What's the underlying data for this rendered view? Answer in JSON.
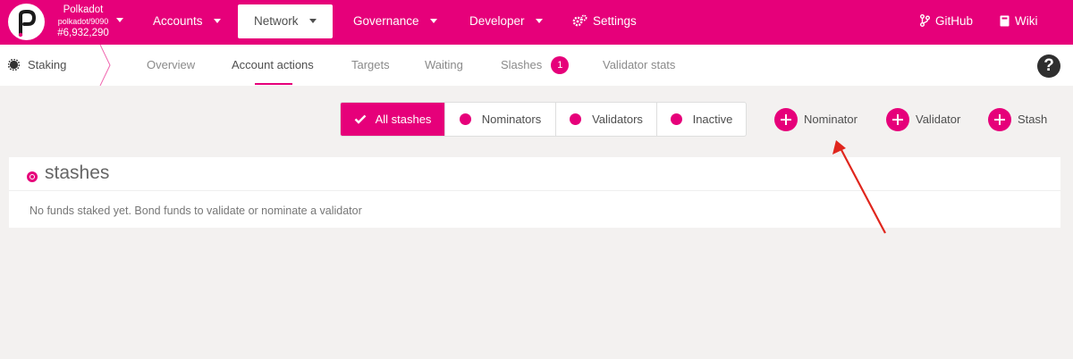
{
  "topbar": {
    "chain_name": "Polkadot",
    "node": "polkadot/9090",
    "block": "#6,932,290",
    "nav": [
      {
        "label": "Accounts"
      },
      {
        "label": "Network"
      },
      {
        "label": "Governance"
      },
      {
        "label": "Developer"
      },
      {
        "label": "Settings"
      }
    ],
    "github": "GitHub",
    "wiki": "Wiki"
  },
  "subbar": {
    "title": "Staking",
    "tabs": [
      {
        "label": "Overview"
      },
      {
        "label": "Account actions"
      },
      {
        "label": "Targets"
      },
      {
        "label": "Waiting"
      },
      {
        "label": "Slashes",
        "badge": "1"
      },
      {
        "label": "Validator stats"
      }
    ],
    "help": "?"
  },
  "filters": [
    {
      "label": "All stashes"
    },
    {
      "label": "Nominators"
    },
    {
      "label": "Validators"
    },
    {
      "label": "Inactive"
    }
  ],
  "actions": {
    "nominator": "Nominator",
    "validator": "Validator",
    "stash": "Stash"
  },
  "stashes": {
    "title": "stashes",
    "empty": "No funds staked yet. Bond funds to validate or nominate a validator"
  },
  "colors": {
    "accent": "#e6007a",
    "annotation_arrow": "#e0261d"
  },
  "icons": {
    "logo": "polkadot-logo-icon",
    "settings": "gear-icon",
    "github": "branch-icon",
    "wiki": "book-icon",
    "help": "question-icon",
    "check": "check-icon",
    "add": "plus-icon"
  }
}
